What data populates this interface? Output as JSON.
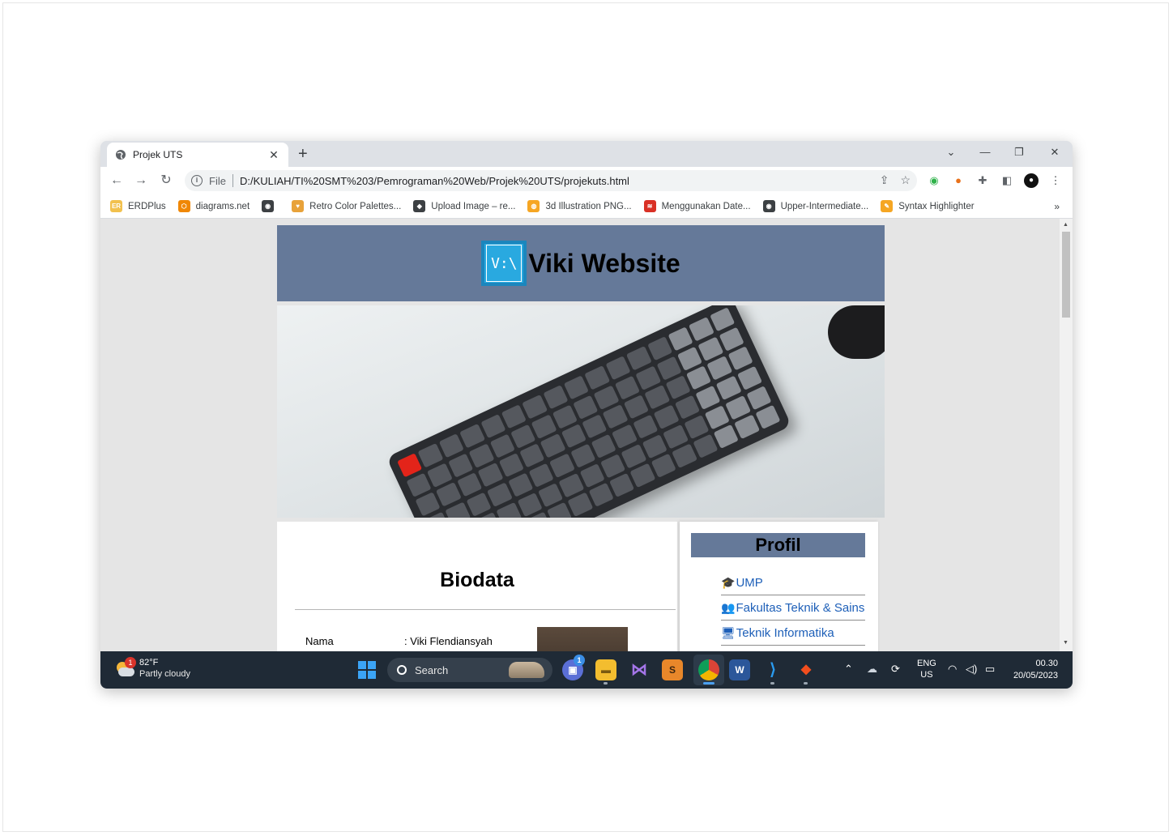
{
  "browser": {
    "tab_title": "Projek UTS",
    "tab_close": "✕",
    "new_tab": "+",
    "window_controls": [
      "⌄",
      "—",
      "❐",
      "✕"
    ],
    "omnibox_file_label": "File",
    "url": "D:/KULIAH/TI%20SMT%203/Pemrograman%20Web/Projek%20UTS/projekuts.html",
    "bookmarks": [
      {
        "label": "ERDPlus",
        "icon": "erdplus-icon",
        "color": "#f2c14e",
        "glyph": "ER"
      },
      {
        "label": "diagrams.net",
        "icon": "drawio-icon",
        "color": "#f08705",
        "glyph": "⬡"
      },
      {
        "label": "",
        "icon": "globe-icon",
        "color": "#3c4043",
        "glyph": "◉"
      },
      {
        "label": "Retro Color Palettes...",
        "icon": "palette-icon",
        "color": "#e8a23a",
        "glyph": "♥"
      },
      {
        "label": "Upload Image – re...",
        "icon": "upload-icon",
        "color": "#3c4043",
        "glyph": "◆"
      },
      {
        "label": "3d Illustration PNG...",
        "icon": "illustration-icon",
        "color": "#f6a623",
        "glyph": "◍"
      },
      {
        "label": "Menggunakan Date...",
        "icon": "stack-icon",
        "color": "#d93025",
        "glyph": "≋"
      },
      {
        "label": "Upper-Intermediate...",
        "icon": "globe-icon",
        "color": "#3c4043",
        "glyph": "◉"
      },
      {
        "label": "Syntax Highlighter",
        "icon": "highlighter-icon",
        "color": "#f5a623",
        "glyph": "✎"
      }
    ],
    "bookmarks_more": "»"
  },
  "site": {
    "logo_text": "V:\\",
    "title": "Viki Website",
    "biodata_title": "Biodata",
    "bio_rows": [
      {
        "label": "Nama",
        "value": ": Viki Flendiansyah"
      }
    ],
    "profil_title": "Profil",
    "profil_links": [
      {
        "label": "UMP",
        "icon": "graduation-cap-icon",
        "glyph": "🎓"
      },
      {
        "label": "Fakultas Teknik & Sains",
        "icon": "users-icon",
        "glyph": "👥"
      },
      {
        "label": "Teknik Informatika",
        "icon": "computer-icon",
        "glyph": "🖥"
      }
    ]
  },
  "taskbar": {
    "weather_temp": "82°F",
    "weather_desc": "Partly cloudy",
    "weather_badge": "1",
    "search_label": "Search",
    "teams_badge": "1",
    "lang_top": "ENG",
    "lang_bottom": "US",
    "time": "00.30",
    "date": "20/05/2023"
  },
  "colors": {
    "header_bg": "#657999",
    "link": "#1d5fb8",
    "taskbar_bg": "#1f2a36"
  }
}
